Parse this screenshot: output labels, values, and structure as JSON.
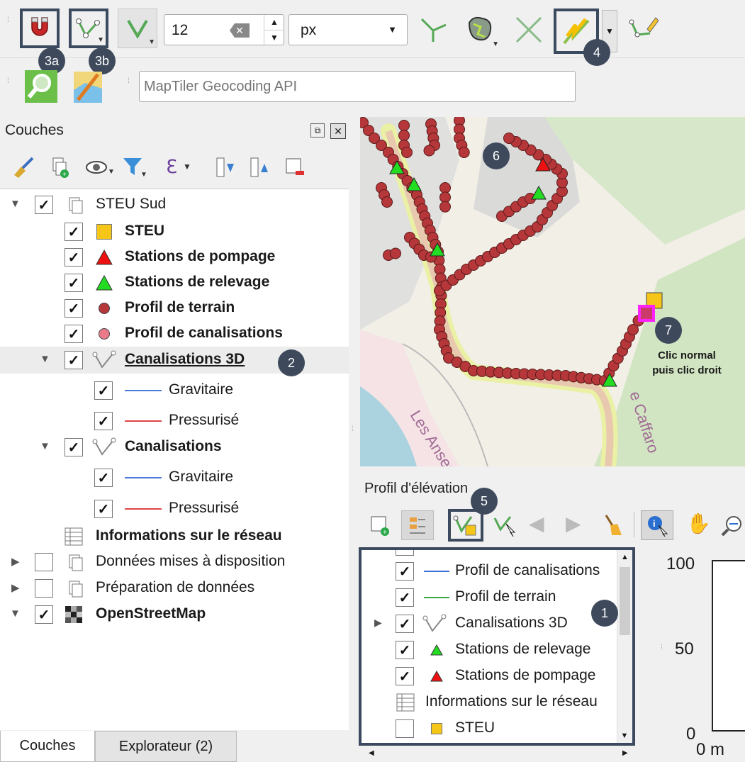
{
  "toolbar": {
    "tolerance_value": "12",
    "unit_value": "px"
  },
  "search": {
    "placeholder": "MapTiler Geocoding API"
  },
  "callouts": {
    "c3a": "3a",
    "c3b": "3b",
    "c4": "4",
    "c2": "2",
    "c5": "5",
    "c6": "6",
    "c7": "7",
    "c1": "1"
  },
  "layers_panel": {
    "title": "Couches",
    "items": [
      {
        "label": "STEU Sud"
      },
      {
        "label": "STEU"
      },
      {
        "label": "Stations de pompage"
      },
      {
        "label": "Stations de relevage"
      },
      {
        "label": "Profil de terrain"
      },
      {
        "label": "Profil de canalisations"
      },
      {
        "label": "Canalisations 3D"
      },
      {
        "label": "Gravitaire"
      },
      {
        "label": "Pressurisé"
      },
      {
        "label": "Canalisations"
      },
      {
        "label": "Gravitaire"
      },
      {
        "label": "Pressurisé"
      },
      {
        "label": "Informations sur le réseau"
      },
      {
        "label": "Données mises à disposition"
      },
      {
        "label": "Préparation de données"
      },
      {
        "label": "OpenStreetMap"
      }
    ]
  },
  "bottom_tabs": {
    "couches": "Couches",
    "explorateur": "Explorateur (2)"
  },
  "map": {
    "annotation_line1": "Clic normal",
    "annotation_line2": "puis clic droit",
    "street_label1": "Les Anses",
    "street_label2": "e Caffaro"
  },
  "profile_panel": {
    "title": "Profil d'élévation",
    "items": [
      {
        "label": "Profil de canalisations"
      },
      {
        "label": "Profil de terrain"
      },
      {
        "label": "Canalisations 3D"
      },
      {
        "label": "Stations de relevage"
      },
      {
        "label": "Stations de pompage"
      },
      {
        "label": "Informations sur le réseau"
      },
      {
        "label": "STEU"
      }
    ],
    "axis_100": "100",
    "axis_50": "50",
    "axis_0": "0",
    "axis_0m": "0 m"
  },
  "colors": {
    "callout": "#3e4a5c",
    "highlight_border": "#3b4a5e",
    "gravitaire": "#4a78d8",
    "pressurise": "#e04545",
    "pipe_point": "#b5373a",
    "relevage": "#22dd22",
    "pompage": "#ee1111",
    "steu": "#f5c518"
  }
}
